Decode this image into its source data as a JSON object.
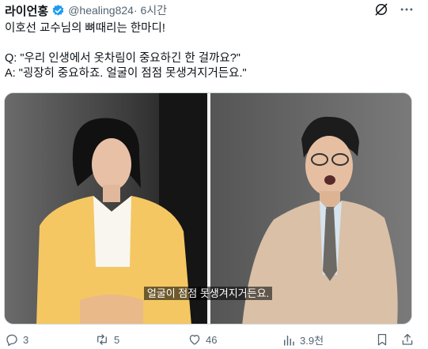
{
  "post": {
    "author_name": "라이언홍",
    "handle": "@healing824",
    "time": " · 6시간",
    "text": {
      "line1": "이호선 교수님의 뼈때리는 한마디!",
      "question": "Q: \"우리 인생에서 옷차림이 중요하긴 한 걸까요?\"",
      "answer": "A: \"굉장히 중요하죠. 얼굴이 점점 못생겨지거든요.\""
    },
    "media": {
      "subtitle": "얼굴이 점점 못생겨지거든요."
    }
  },
  "actions": {
    "replies": "3",
    "reposts": "5",
    "likes": "46",
    "views": "3.9천"
  },
  "icons": {
    "verified": "verified-badge-icon",
    "grok": "grok-icon",
    "more": "more-icon",
    "reply": "reply-icon",
    "repost": "repost-icon",
    "like": "like-icon",
    "views": "views-icon",
    "bookmark": "bookmark-icon",
    "share": "share-icon"
  },
  "colors": {
    "text": "#0f1419",
    "secondary": "#536471",
    "verified": "#1d9bf0",
    "background": "#ffffff"
  }
}
